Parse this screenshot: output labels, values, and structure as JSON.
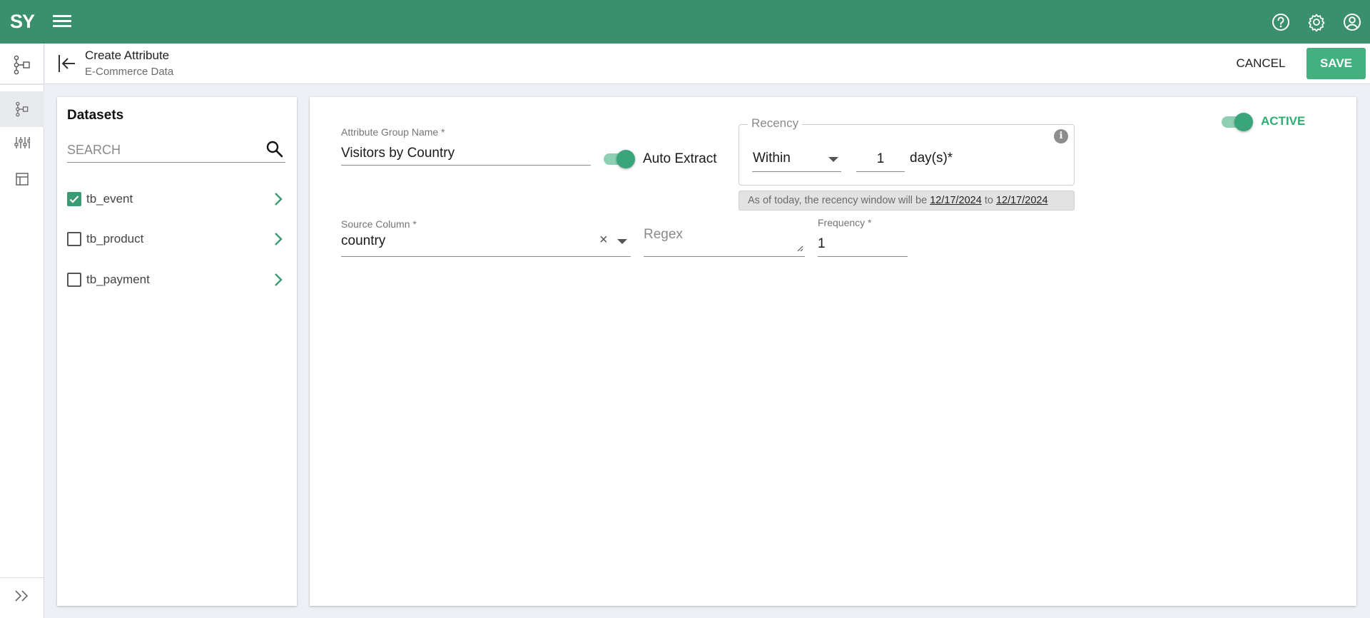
{
  "app": {
    "logo_text": "SY"
  },
  "subheader": {
    "title": "Create Attribute",
    "subtitle": "E-Commerce Data",
    "cancel_label": "CANCEL",
    "save_label": "SAVE"
  },
  "datasets": {
    "title": "Datasets",
    "search_placeholder": "SEARCH",
    "items": [
      {
        "label": "tb_event",
        "checked": true
      },
      {
        "label": "tb_product",
        "checked": false
      },
      {
        "label": "tb_payment",
        "checked": false
      }
    ]
  },
  "form": {
    "group_name": {
      "label": "Attribute Group Name *",
      "value": "Visitors by Country"
    },
    "auto_extract": {
      "label": "Auto Extract",
      "on": true
    },
    "recency": {
      "legend": "Recency",
      "operator": "Within",
      "days_value": "1",
      "days_label": "day(s)*",
      "note_prefix": "As of today, the recency window will be",
      "note_start": "12/17/2024",
      "note_to": "to",
      "note_end": "12/17/2024"
    },
    "source_column": {
      "label": "Source Column *",
      "value": "country"
    },
    "regex": {
      "placeholder": "Regex",
      "value": ""
    },
    "frequency": {
      "label": "Frequency *",
      "value": "1"
    },
    "active": {
      "label": "ACTIVE",
      "on": true
    }
  },
  "colors": {
    "brand": "#3a8f6c",
    "save_button": "#43b17f",
    "active_text": "#2fae70",
    "toggle_thumb": "#3aa57a",
    "toggle_track": "#8fd0b2"
  },
  "icons": {
    "top_right": [
      "help-circle-icon",
      "gear-icon",
      "account-circle-icon"
    ],
    "nav": [
      "hierarchy-icon",
      "hierarchy-icon",
      "sliders-icon",
      "layout-icon",
      "double-chevron-right-icon"
    ],
    "header_back": "back-arrow-icon",
    "search": "search-icon",
    "chevron": "chevron-right-icon"
  }
}
